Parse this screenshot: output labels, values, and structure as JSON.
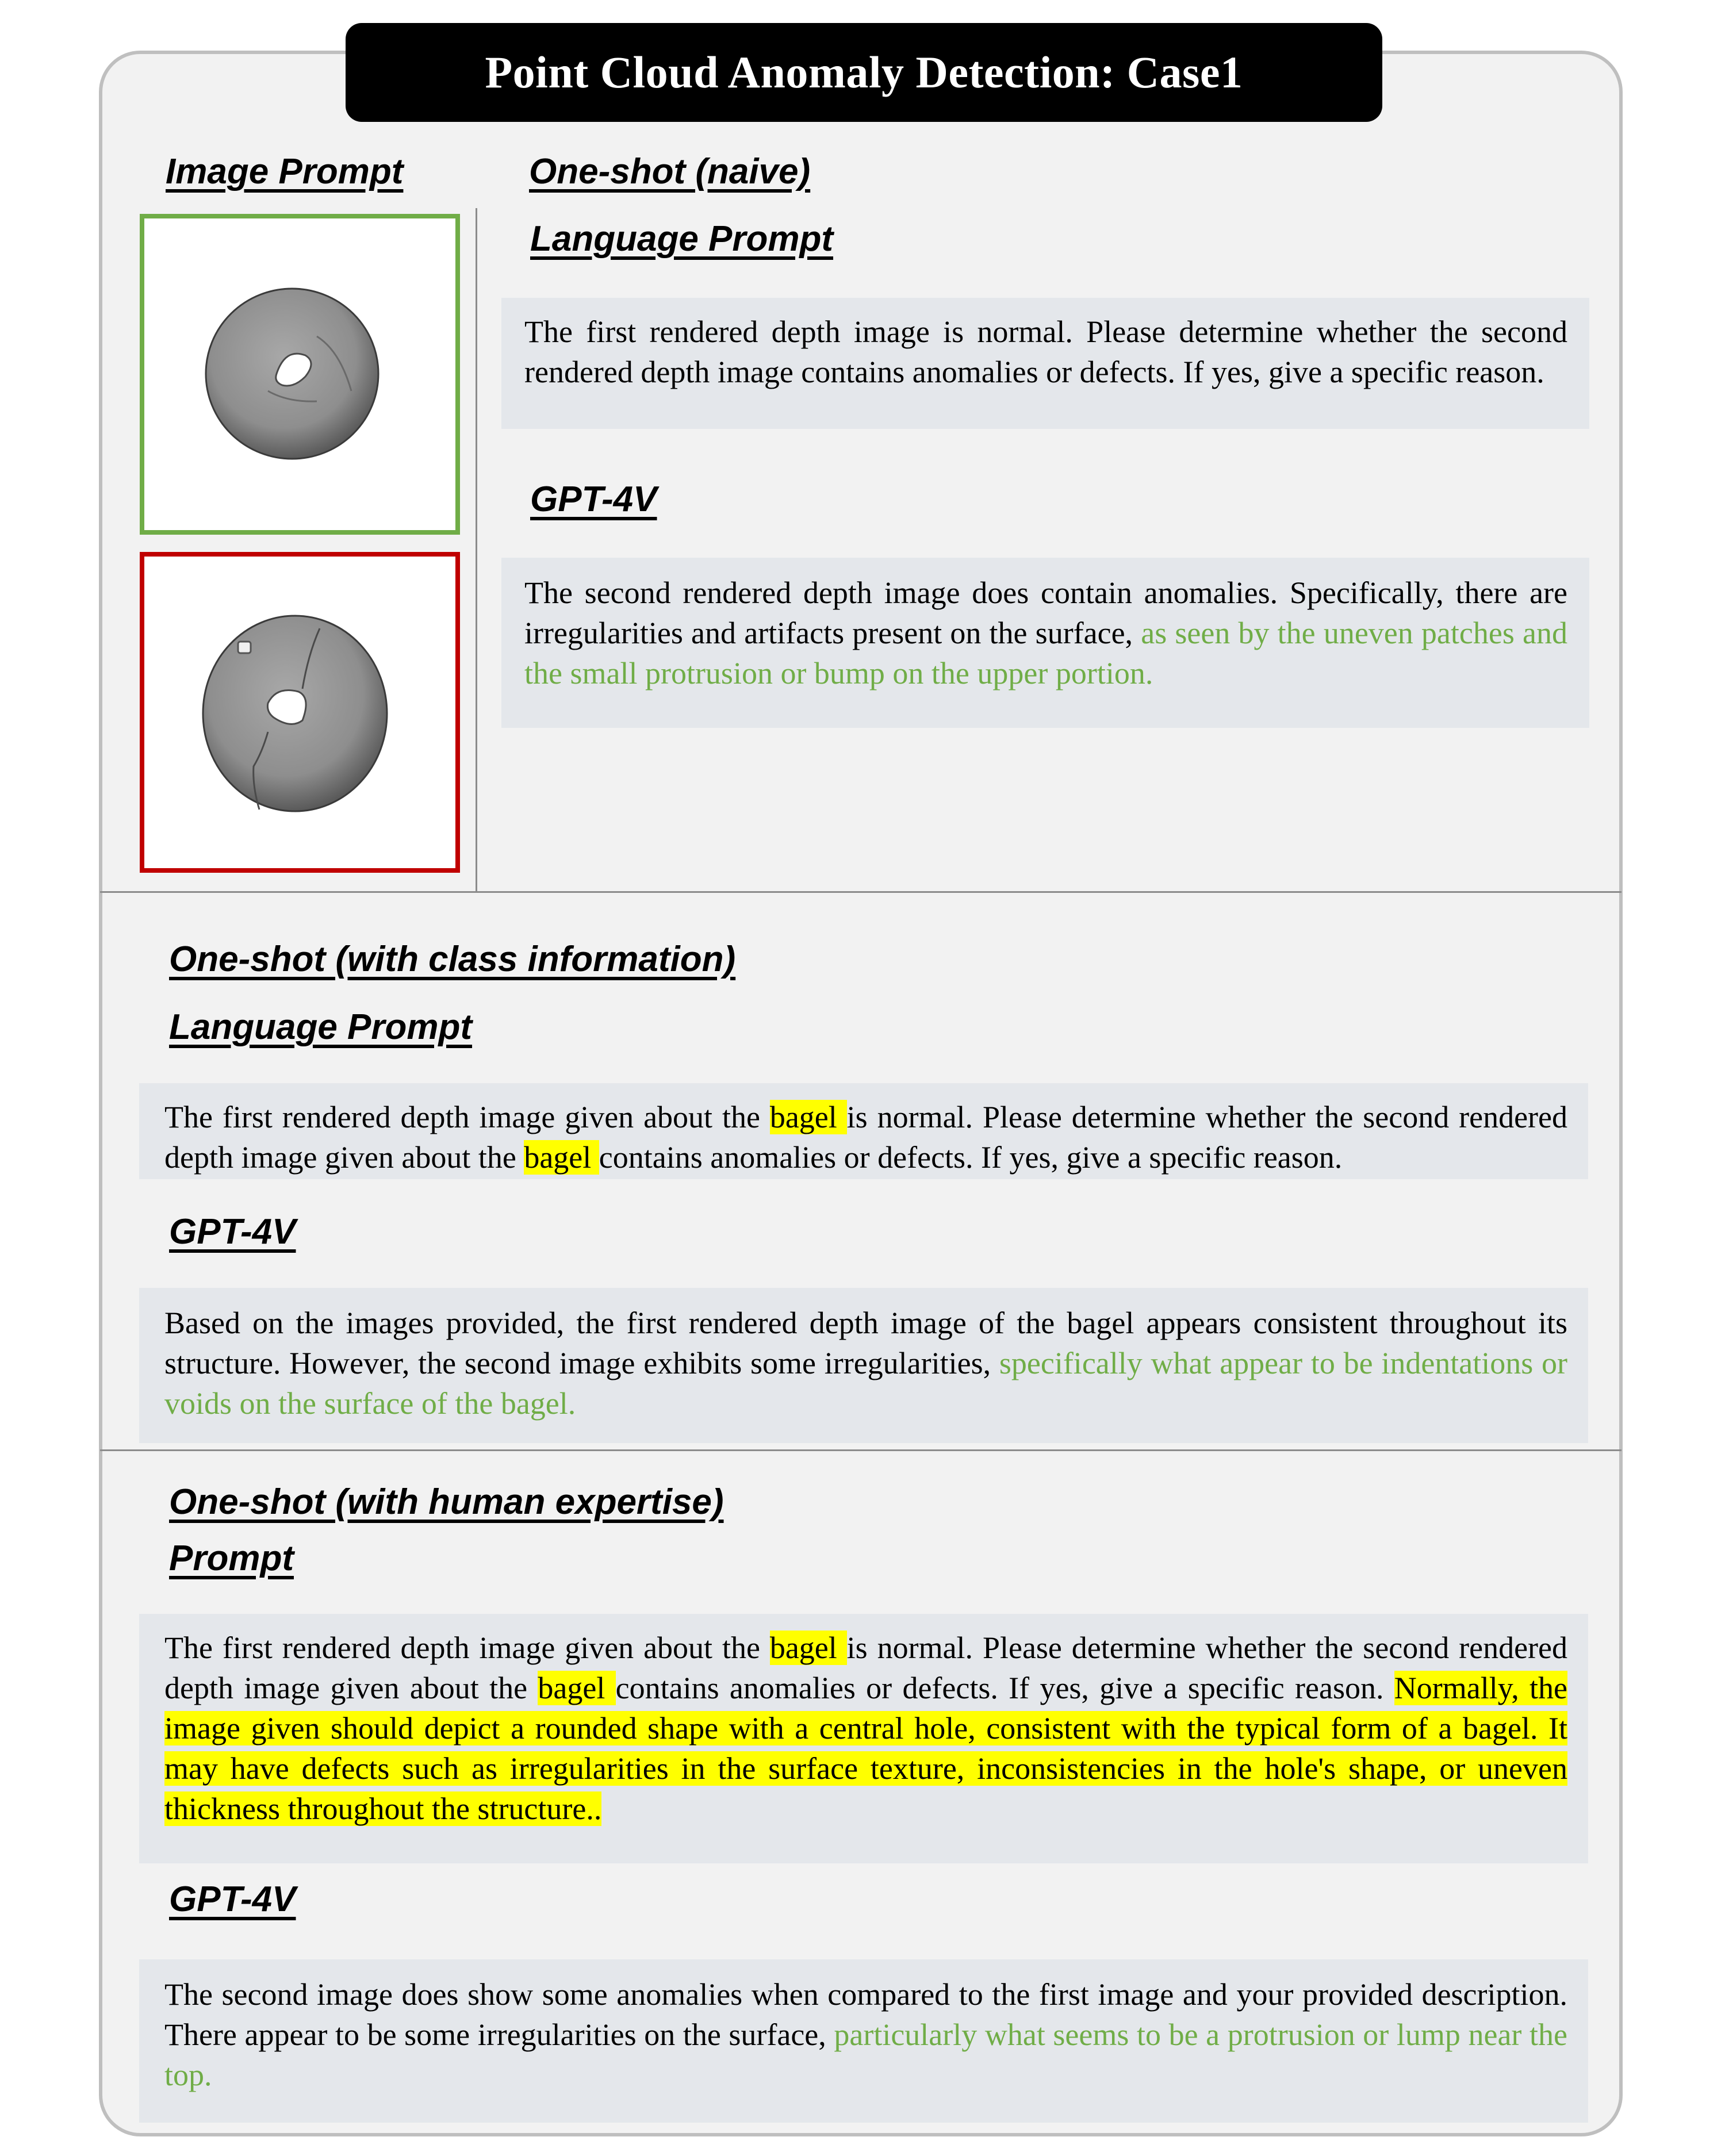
{
  "title": "Point Cloud Anomaly Detection: Case1",
  "colors": {
    "normal_frame": "#70ad47",
    "anomaly_frame": "#c00000",
    "answer_highlight_text": "#70ad47",
    "keyword_highlight": "#ffff00",
    "textbox_background": "#e4e7eb",
    "card_background": "#f2f2f2"
  },
  "image_prompt": {
    "heading": "Image Prompt",
    "images": [
      {
        "label": "normal bagel depth render",
        "status": "normal"
      },
      {
        "label": "anomalous bagel depth render",
        "status": "anomalous"
      }
    ]
  },
  "sections": [
    {
      "heading": "One-shot (naive)",
      "prompt_heading": "Language Prompt",
      "prompt_segments": [
        {
          "text": "The first rendered depth image is normal. Please determine whether the second rendered depth image contains anomalies or defects. If yes, give a specific reason.",
          "style": "plain"
        }
      ],
      "response_heading": "GPT-4V",
      "response_segments": [
        {
          "text": "The second rendered depth image does contain anomalies. Specifically, there are irregularities and artifacts present on the surface, ",
          "style": "plain"
        },
        {
          "text": "as seen by the uneven patches and the small protrusion or bump on the upper portion.",
          "style": "green"
        }
      ]
    },
    {
      "heading": "One-shot (with class information)",
      "prompt_heading": "Language Prompt",
      "prompt_segments": [
        {
          "text": "The first rendered depth image given about the ",
          "style": "plain"
        },
        {
          "text": "bagel ",
          "style": "highlight"
        },
        {
          "text": "is normal. Please determine whether the second rendered depth image given about the ",
          "style": "plain"
        },
        {
          "text": "bagel ",
          "style": "highlight"
        },
        {
          "text": "contains anomalies or defects. If yes, give a specific reason.",
          "style": "plain"
        }
      ],
      "response_heading": "GPT-4V",
      "response_segments": [
        {
          "text": "Based on the images provided, the first rendered depth image of the bagel appears consistent throughout its structure. However, the second image exhibits some irregularities, ",
          "style": "plain"
        },
        {
          "text": "specifically what appear to be indentations or voids on the surface of the bagel.",
          "style": "green"
        }
      ]
    },
    {
      "heading": "One-shot (with human expertise)",
      "prompt_heading": "Prompt",
      "prompt_segments": [
        {
          "text": "The first rendered depth image given  about the ",
          "style": "plain"
        },
        {
          "text": "bagel ",
          "style": "highlight"
        },
        {
          "text": "is normal. Please determine whether the second rendered depth image given about the ",
          "style": "plain"
        },
        {
          "text": "bagel ",
          "style": "highlight"
        },
        {
          "text": "contains anomalies or defects. If yes, give a specific reason. ",
          "style": "plain"
        },
        {
          "text": "Normally, the image given should depict a rounded shape with a central hole, consistent with the typical form of a bagel. It may have defects such as irregularities in the surface texture, inconsistencies in the hole's shape, or uneven thickness throughout the structure..",
          "style": "highlight"
        }
      ],
      "response_heading": "GPT-4V",
      "response_segments": [
        {
          "text": "The second image does show some anomalies when compared to the first image and your provided description. There appear to be some irregularities on the surface, ",
          "style": "plain"
        },
        {
          "text": "particularly what seems to be a protrusion or lump near the top.",
          "style": "green"
        }
      ]
    }
  ]
}
